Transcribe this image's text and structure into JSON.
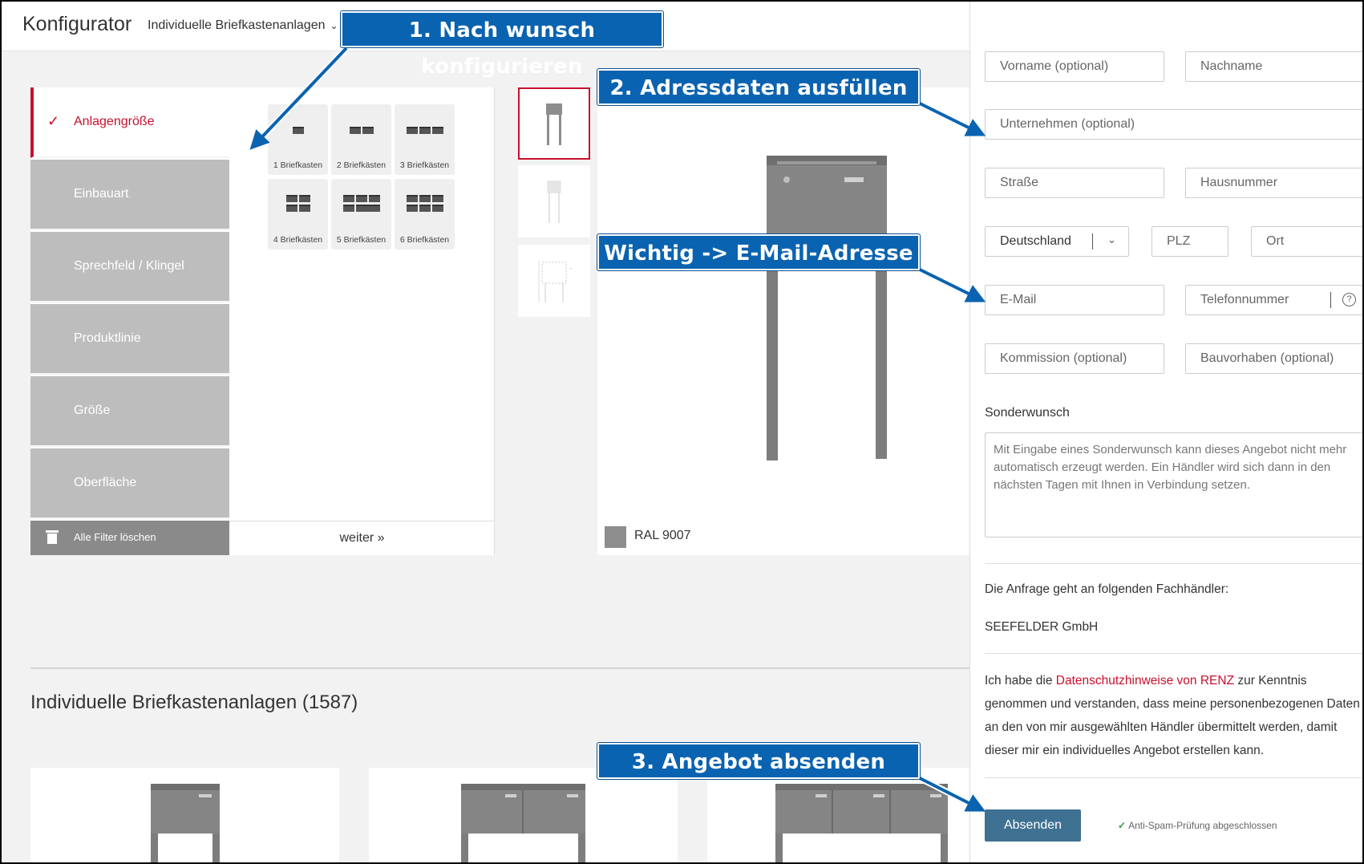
{
  "header": {
    "app_title": "Konfigurator",
    "product_dropdown": "Individuelle Briefkastenanlagen"
  },
  "config": {
    "steps": [
      {
        "label": "Anlagengröße",
        "active": true
      },
      {
        "label": "Einbauart",
        "active": false
      },
      {
        "label": "Sprechfeld / Klingel",
        "active": false
      },
      {
        "label": "Produktlinie",
        "active": false
      },
      {
        "label": "Größe",
        "active": false
      },
      {
        "label": "Oberfläche",
        "active": false
      }
    ],
    "clear_filters": "Alle Filter löschen",
    "next": "weiter »",
    "options": [
      {
        "label": "1 Briefkasten",
        "count": 1
      },
      {
        "label": "2 Briefkästen",
        "count": 2
      },
      {
        "label": "3 Briefkästen",
        "count": 3
      },
      {
        "label": "4 Briefkästen",
        "count": 4
      },
      {
        "label": "5 Briefkästen",
        "count": 5
      },
      {
        "label": "6 Briefkästen",
        "count": 6
      }
    ]
  },
  "preview": {
    "color_label": "RAL 9007",
    "color_hex": "#8d8d8d"
  },
  "form": {
    "first_name": "Vorname (optional)",
    "last_name": "Nachname",
    "company": "Unternehmen (optional)",
    "street": "Straße",
    "house_number": "Hausnummer",
    "country": "Deutschland",
    "zip": "PLZ",
    "city": "Ort",
    "email": "E-Mail",
    "phone": "Telefonnummer",
    "commission": "Kommission (optional)",
    "project": "Bauvorhaben (optional)",
    "special_request_label": "Sonderwunsch",
    "special_request_placeholder": "Mit Eingabe eines Sonderwunsch kann dieses Angebot nicht mehr automatisch erzeugt werden. Ein Händler wird sich dann in den nächsten Tagen mit Ihnen in Verbindung setzen.",
    "dealer_intro": "Die Anfrage geht an folgenden Fachhändler:",
    "dealer_name": "SEEFELDER GmbH",
    "consent_pre": "Ich habe die ",
    "consent_link": "Datenschutzhinweise von RENZ",
    "consent_post": " zur Kenntnis genommen und verstanden, dass meine personenbezogenen Daten an den von mir ausgewählten Händler übermittelt werden, damit dieser mir ein individuelles Angebot erstellen kann.",
    "submit": "Absenden",
    "spam_check": "Anti-Spam-Prüfung abgeschlossen"
  },
  "listing": {
    "title": "Individuelle Briefkastenanlagen (1587)"
  },
  "callouts": {
    "step1": "1. Nach wunsch konfigurieren",
    "step2": "2. Adressdaten ausfüllen",
    "important": "Wichtig -> E-Mail-Adresse",
    "step3": "3. Angebot absenden"
  },
  "colors": {
    "accent_red": "#c8102e",
    "callout_blue": "#0a63b0",
    "submit_blue": "#3f7192"
  }
}
